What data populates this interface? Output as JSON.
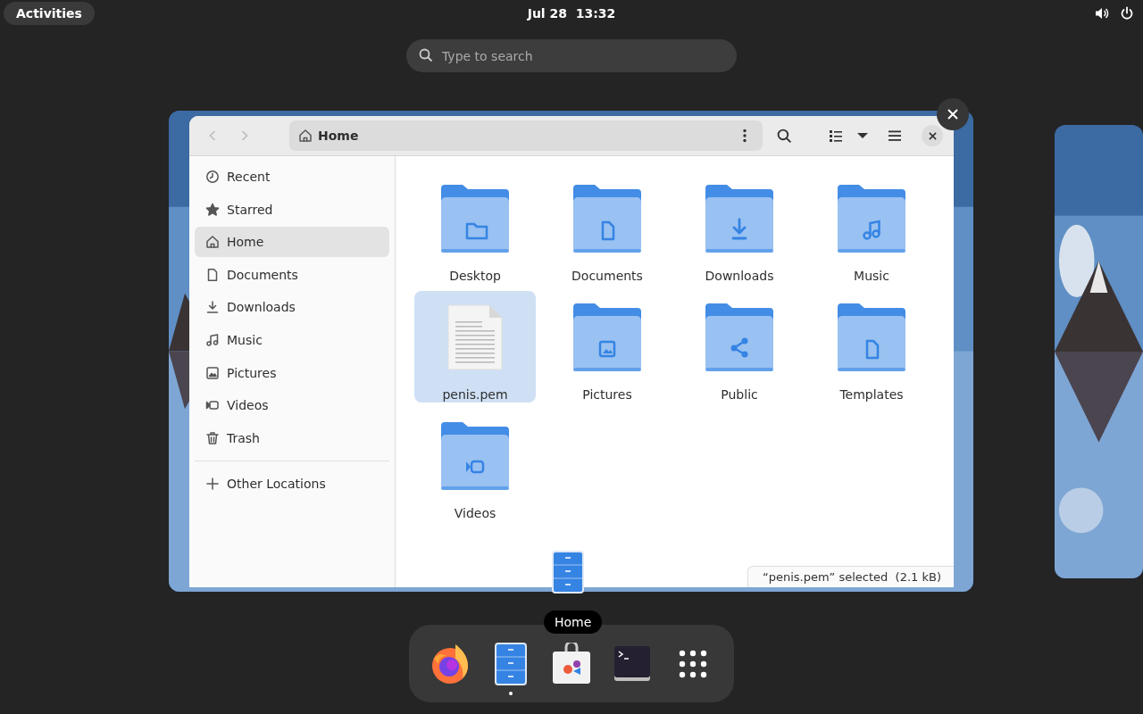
{
  "top_bar": {
    "activities": "Activities",
    "clock": "Jul 28  13:32"
  },
  "search": {
    "placeholder": "Type to search"
  },
  "window": {
    "path": "Home",
    "sidebar": [
      {
        "label": "Recent",
        "kind": "recent",
        "selected": false
      },
      {
        "label": "Starred",
        "kind": "starred",
        "selected": false
      },
      {
        "label": "Home",
        "kind": "home",
        "selected": true
      },
      {
        "label": "Documents",
        "kind": "documents",
        "selected": false
      },
      {
        "label": "Downloads",
        "kind": "downloads",
        "selected": false
      },
      {
        "label": "Music",
        "kind": "music",
        "selected": false
      },
      {
        "label": "Pictures",
        "kind": "pictures",
        "selected": false
      },
      {
        "label": "Videos",
        "kind": "videos",
        "selected": false
      },
      {
        "label": "Trash",
        "kind": "trash",
        "selected": false
      }
    ],
    "other_locations": "Other Locations",
    "items": [
      {
        "name": "Desktop",
        "kind": "desktop",
        "selected": false
      },
      {
        "name": "Documents",
        "kind": "documents",
        "selected": false
      },
      {
        "name": "Downloads",
        "kind": "downloads",
        "selected": false
      },
      {
        "name": "Music",
        "kind": "music",
        "selected": false
      },
      {
        "name": "penis.pem",
        "kind": "file",
        "selected": true
      },
      {
        "name": "Pictures",
        "kind": "pictures",
        "selected": false
      },
      {
        "name": "Public",
        "kind": "public",
        "selected": false
      },
      {
        "name": "Templates",
        "kind": "templates",
        "selected": false
      },
      {
        "name": "Videos",
        "kind": "videos",
        "selected": false
      }
    ],
    "status": "“penis.pem” selected  (2.1 kB)"
  },
  "drag_tooltip": "Home",
  "dash": [
    {
      "kind": "browser",
      "running": false
    },
    {
      "kind": "files",
      "running": true
    },
    {
      "kind": "software",
      "running": false
    },
    {
      "kind": "terminal",
      "running": false
    },
    {
      "kind": "apps",
      "running": false
    }
  ]
}
